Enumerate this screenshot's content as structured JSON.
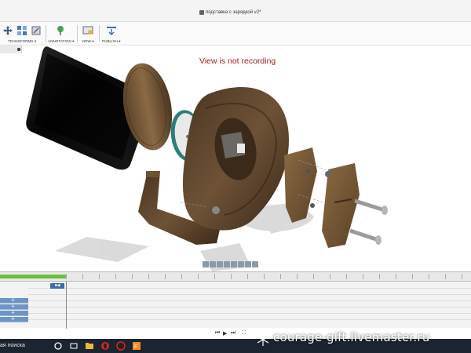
{
  "window": {
    "title": "подставка с зарядкой v2*"
  },
  "toolbar": {
    "groups": [
      {
        "label": "TRANSFORMS ▾",
        "icon": "move-icon"
      },
      {
        "label": "ANNOTATION ▾",
        "icon": "pin-icon"
      },
      {
        "label": "VIEW ▾",
        "icon": "view-icon"
      },
      {
        "label": "PUBLISH ▾",
        "icon": "publish-icon"
      }
    ]
  },
  "viewport": {
    "recording_message": "View is not recording"
  },
  "taskbar": {
    "search_placeholder": "ая поиска"
  },
  "watermark": {
    "text": "courage-gift.livemaster.ru"
  },
  "colors": {
    "timeline_green": "#6cbf3c",
    "timeline_blue": "#6d95c4",
    "recording_red": "#b01818",
    "taskbar_bg": "#1c2431"
  }
}
